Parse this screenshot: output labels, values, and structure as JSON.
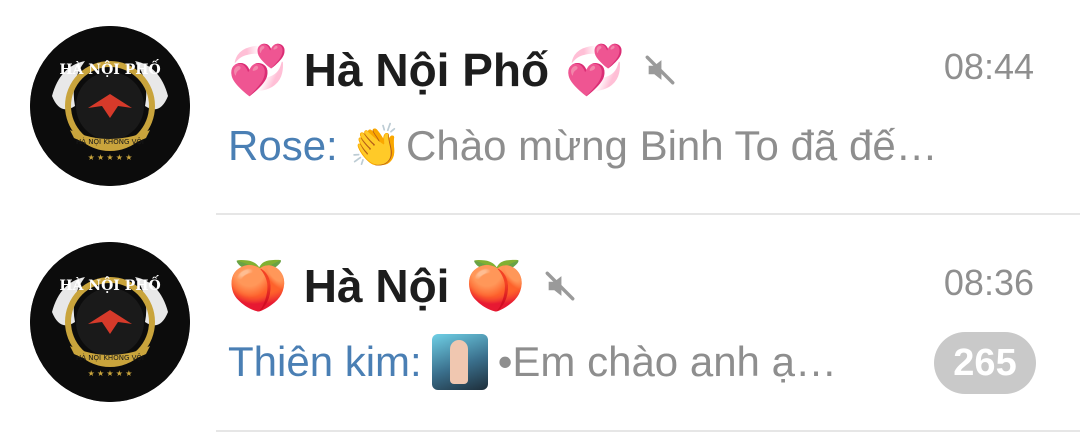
{
  "chats": [
    {
      "name": "Hà Nội Phố",
      "name_emoji_left": "💞",
      "name_emoji_right": "💞",
      "muted": true,
      "time": "08:44",
      "sender": "Rose:",
      "preview_emoji": "👏",
      "preview": "Chào mừng Binh To đã đế…",
      "unread": null,
      "avatar_logo_text": "HÀ NỘI PHỐ",
      "avatar_logo_sub": "HÀ NỘI KHÔNG VỘI"
    },
    {
      "name": "Hà Nội",
      "name_emoji_left": "🍑",
      "name_emoji_right": "🍑",
      "muted": true,
      "time": "08:36",
      "sender": "Thiên kim:",
      "preview": "•Em chào anh ạ…",
      "unread": "265",
      "avatar_logo_text": "HÀ NỘI PHỐ",
      "avatar_logo_sub": "HÀ NỘI KHÔNG VỘI"
    }
  ],
  "colors": {
    "sender": "#4a7fb4",
    "muted_text": "#8e8e8e",
    "badge_bg": "#c9c9c9",
    "divider": "#e6e6e6"
  }
}
